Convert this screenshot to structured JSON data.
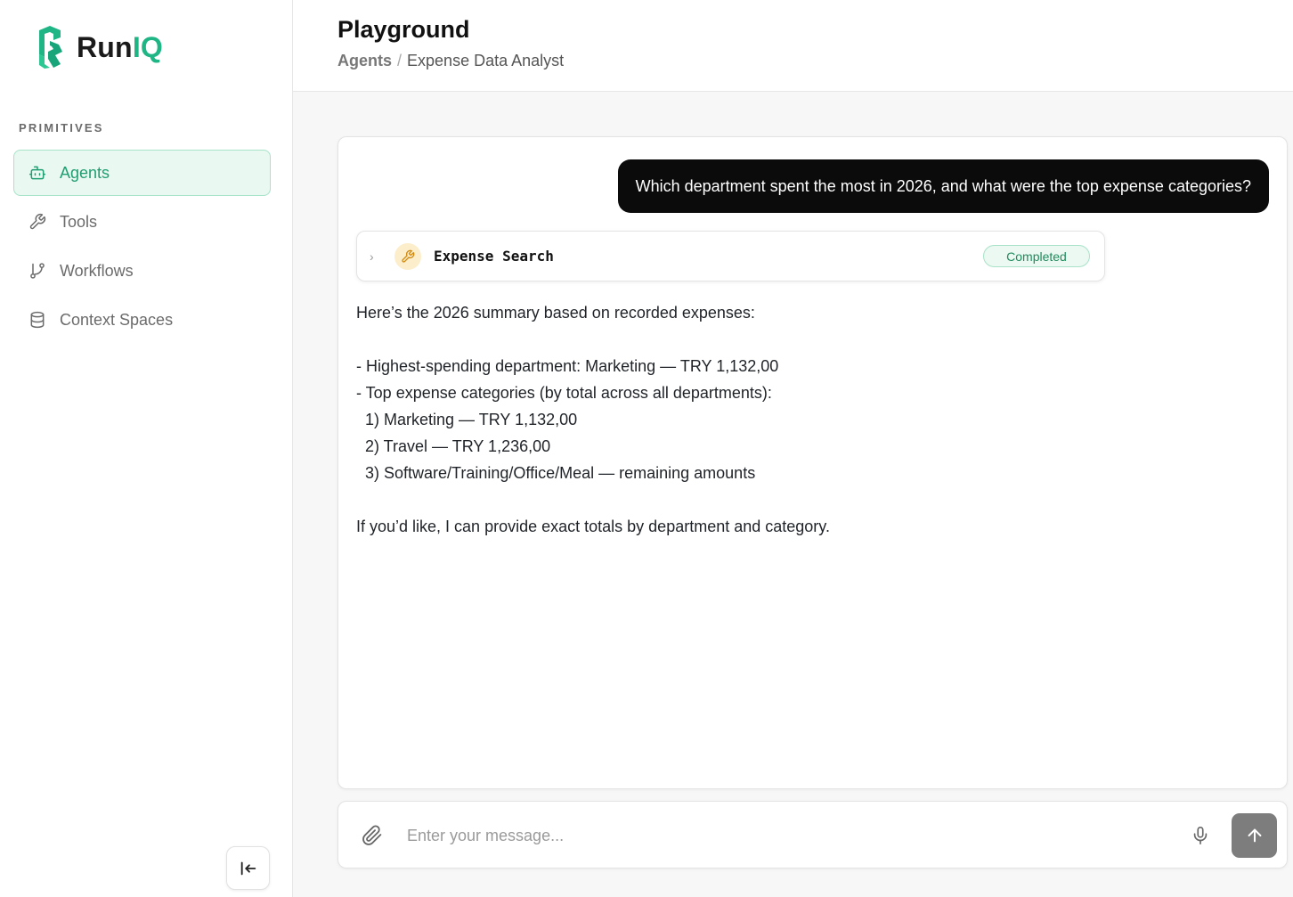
{
  "brand": {
    "name_part1": "Run",
    "name_part2": "IQ",
    "accent_color": "#1fb585"
  },
  "sidebar": {
    "section_label": "PRIMITIVES",
    "items": [
      {
        "label": "Agents",
        "icon": "bot-icon",
        "active": true
      },
      {
        "label": "Tools",
        "icon": "wrench-icon",
        "active": false
      },
      {
        "label": "Workflows",
        "icon": "git-branch-icon",
        "active": false
      },
      {
        "label": "Context Spaces",
        "icon": "database-icon",
        "active": false
      }
    ],
    "collapse_icon": "collapse-left-icon"
  },
  "header": {
    "title": "Playground",
    "breadcrumb": {
      "parent": "Agents",
      "separator": "/",
      "current": "Expense Data Analyst"
    }
  },
  "chat": {
    "user_message": "Which department spent the most in 2026, and what were the top expense categories?",
    "tool_call": {
      "name": "Expense Search",
      "status": "Completed",
      "icon": "wrench-icon",
      "expand_icon": "chevron-right-icon"
    },
    "assistant_lines": [
      "Here’s the 2026 summary based on recorded expenses:",
      "",
      "- Highest-spending department: Marketing — TRY 1,132,00",
      "- Top expense categories (by total across all departments):",
      "  1) Marketing — TRY 1,132,00",
      "  2) Travel — TRY 1,236,00",
      "  3) Software/Training/Office/Meal — remaining amounts",
      "",
      "If you’d like, I can provide exact totals by department and category."
    ]
  },
  "composer": {
    "placeholder": "Enter your message...",
    "attach_icon": "paperclip-icon",
    "mic_icon": "microphone-icon",
    "send_icon": "arrow-up-icon"
  },
  "colors": {
    "active_nav_bg": "#e9f8f1",
    "active_nav_text": "#1f9e72",
    "badge_text": "#1f8a5c",
    "user_bubble_bg": "#0b0b0b",
    "send_button_bg": "#7d7d7d"
  }
}
